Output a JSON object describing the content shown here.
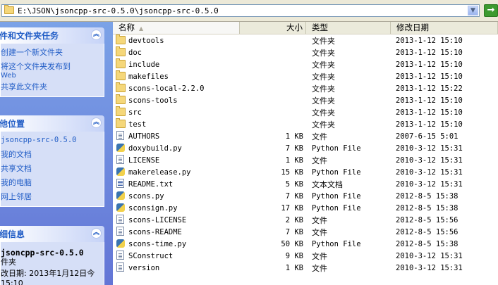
{
  "address": {
    "path": "E:\\JSON\\jsoncpp-src-0.5.0\\jsoncpp-src-0.5.0",
    "dropdown_icon": "chevron-down-icon",
    "go_icon": "arrow-right-icon",
    "go_color": "#3c9a2f"
  },
  "tasks_panel": {
    "title": "件和文件夹任务",
    "links": [
      "创建一个新文件夹",
      "将这个文件夹发布到",
      "Web",
      "共享此文件夹"
    ]
  },
  "places_panel": {
    "title": "他位置",
    "links": [
      "jsoncpp-src-0.5.0",
      "我的文档",
      "共享文档",
      "我的电脑",
      "网上邻居"
    ]
  },
  "details_panel": {
    "title": "细信息",
    "name": "jsoncpp-src-0.5.0",
    "type": "件夹",
    "modified": "改日期: 2013年1月12日今",
    "time": "15:10"
  },
  "columns": {
    "name": "名称",
    "size": "大小",
    "type": "类型",
    "modified": "修改日期"
  },
  "files": [
    {
      "icon": "folder",
      "name": "devtools",
      "size": "",
      "type": "文件夹",
      "modified": "2013-1-12 15:10"
    },
    {
      "icon": "folder",
      "name": "doc",
      "size": "",
      "type": "文件夹",
      "modified": "2013-1-12 15:10"
    },
    {
      "icon": "folder",
      "name": "include",
      "size": "",
      "type": "文件夹",
      "modified": "2013-1-12 15:10"
    },
    {
      "icon": "folder",
      "name": "makefiles",
      "size": "",
      "type": "文件夹",
      "modified": "2013-1-12 15:10"
    },
    {
      "icon": "folder",
      "name": "scons-local-2.2.0",
      "size": "",
      "type": "文件夹",
      "modified": "2013-1-12 15:22"
    },
    {
      "icon": "folder",
      "name": "scons-tools",
      "size": "",
      "type": "文件夹",
      "modified": "2013-1-12 15:10"
    },
    {
      "icon": "folder",
      "name": "src",
      "size": "",
      "type": "文件夹",
      "modified": "2013-1-12 15:10"
    },
    {
      "icon": "folder",
      "name": "test",
      "size": "",
      "type": "文件夹",
      "modified": "2013-1-12 15:10"
    },
    {
      "icon": "file",
      "name": "AUTHORS",
      "size": "1 KB",
      "type": "文件",
      "modified": "2007-6-15 5:01"
    },
    {
      "icon": "python",
      "name": "doxybuild.py",
      "size": "7 KB",
      "type": "Python File",
      "modified": "2010-3-12 15:31"
    },
    {
      "icon": "file",
      "name": "LICENSE",
      "size": "1 KB",
      "type": "文件",
      "modified": "2010-3-12 15:31"
    },
    {
      "icon": "python",
      "name": "makerelease.py",
      "size": "15 KB",
      "type": "Python File",
      "modified": "2010-3-12 15:31"
    },
    {
      "icon": "text",
      "name": "README.txt",
      "size": "5 KB",
      "type": "文本文档",
      "modified": "2010-3-12 15:31"
    },
    {
      "icon": "python",
      "name": "scons.py",
      "size": "7 KB",
      "type": "Python File",
      "modified": "2012-8-5 15:38"
    },
    {
      "icon": "python",
      "name": "sconsign.py",
      "size": "17 KB",
      "type": "Python File",
      "modified": "2012-8-5 15:38"
    },
    {
      "icon": "file",
      "name": "scons-LICENSE",
      "size": "2 KB",
      "type": "文件",
      "modified": "2012-8-5 15:56"
    },
    {
      "icon": "file",
      "name": "scons-README",
      "size": "7 KB",
      "type": "文件",
      "modified": "2012-8-5 15:56"
    },
    {
      "icon": "python",
      "name": "scons-time.py",
      "size": "50 KB",
      "type": "Python File",
      "modified": "2012-8-5 15:38"
    },
    {
      "icon": "file",
      "name": "SConstruct",
      "size": "9 KB",
      "type": "文件",
      "modified": "2010-3-12 15:31"
    },
    {
      "icon": "file",
      "name": "version",
      "size": "1 KB",
      "type": "文件",
      "modified": "2010-3-12 15:31"
    }
  ]
}
